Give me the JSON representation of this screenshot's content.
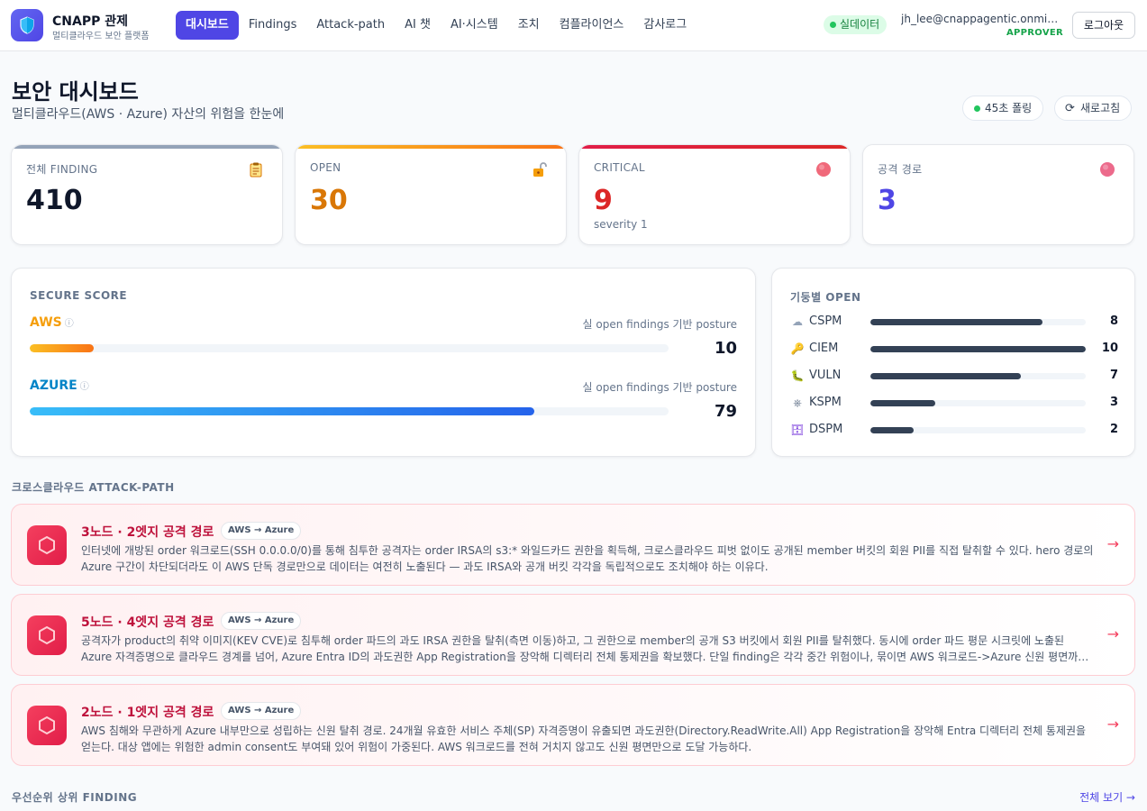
{
  "app": {
    "title": "CNAPP 관제",
    "subtitle": "멀티클라우드 보안 플랫폼"
  },
  "nav": {
    "items": [
      {
        "label": "대시보드",
        "active": true
      },
      {
        "label": "Findings"
      },
      {
        "label": "Attack-path"
      },
      {
        "label": "AI 챗"
      },
      {
        "label": "AI·시스템"
      },
      {
        "label": "조치"
      },
      {
        "label": "컴플라이언스"
      },
      {
        "label": "감사로그"
      }
    ]
  },
  "status": {
    "live_label": "실데이터"
  },
  "user": {
    "email": "jh_lee@cnappagentic.onmicrosoft.com",
    "role": "APPROVER",
    "logout_label": "로그아웃"
  },
  "page": {
    "title": "보안 대시보드",
    "subtitle": "멀티클라우드(AWS · Azure) 자산의 위험을 한눈에",
    "poll_label": "45초 폴링",
    "refresh_label": "새로고침"
  },
  "kpis": [
    {
      "label": "전체 FINDING",
      "value": "410",
      "note": "",
      "color": "#0f172a",
      "bar": "#94a3b8",
      "icon": "clipboard-icon"
    },
    {
      "label": "OPEN",
      "value": "30",
      "note": "",
      "color": "#d97706",
      "bar": "#f59e0b",
      "icon": "unlock-icon"
    },
    {
      "label": "CRITICAL",
      "value": "9",
      "note": "severity 1",
      "color": "#dc2626",
      "bar": "#e11d48",
      "icon": "critical-dot-icon"
    },
    {
      "label": "공격 경로",
      "value": "3",
      "note": "",
      "color": "#4f46e5",
      "bar": "#ffffff",
      "icon": "attack-dot-icon"
    }
  ],
  "secure_score": {
    "title": "SECURE SCORE",
    "providers": [
      {
        "name": "AWS",
        "info_icon": "info-icon",
        "note": "실 open findings 기반 posture",
        "value": 10,
        "display": "10",
        "color": "#f59e0b"
      },
      {
        "name": "AZURE",
        "info_icon": "info-icon",
        "note": "실 open findings 기반 posture",
        "value": 79,
        "display": "79",
        "color": "#0284c7"
      }
    ]
  },
  "pillars": {
    "title": "기둥별 OPEN",
    "max": 10,
    "items": [
      {
        "name": "CSPM",
        "value": 8,
        "display": "8",
        "icon": "cloud-icon",
        "glyph": "☁"
      },
      {
        "name": "CIEM",
        "value": 10,
        "display": "10",
        "icon": "key-icon",
        "glyph": "🔑"
      },
      {
        "name": "VULN",
        "value": 7,
        "display": "7",
        "icon": "bug-icon",
        "glyph": "🐛"
      },
      {
        "name": "KSPM",
        "value": 3,
        "display": "3",
        "icon": "helm-icon",
        "glyph": "⎈"
      },
      {
        "name": "DSPM",
        "value": 2,
        "display": "2",
        "icon": "database-icon",
        "glyph": "🗄"
      }
    ]
  },
  "attack_section": {
    "title": "크로스클라우드 ATTACK-PATH"
  },
  "attack_paths": [
    {
      "title": "3노드 · 2엣지 공격 경로",
      "badge": "AWS → Azure",
      "desc": "인터넷에 개방된 order 워크로드(SSH 0.0.0.0/0)를 통해 침투한 공격자는 order IRSA의 s3:* 와일드카드 권한을 획득해, 크로스클라우드 피벗 없이도 공개된 member 버킷의 회원 PII를 직접 탈취할 수 있다. hero 경로의 Azure 구간이 차단되더라도 이 AWS 단독 경로만으로 데이터는 여전히 노출된다 — 과도 IRSA와 공개 버킷 각각을 독립적으로도 조치해야 하는 이유다.",
      "arrow": "→"
    },
    {
      "title": "5노드 · 4엣지 공격 경로",
      "badge": "AWS → Azure",
      "desc": "공격자가 product의 취약 이미지(KEV CVE)로 침투해 order 파드의 과도 IRSA 권한을 탈취(측면 이동)하고, 그 권한으로 member의 공개 S3 버킷에서 회원 PII를 탈취했다. 동시에 order 파드 평문 시크릿에 노출된 Azure 자격증명으로 클라우드 경계를 넘어, Azure Entra ID의 과도권한 App Registration을 장악해 디렉터리 전체 통제권을 확보했다. 단일 finding은 각각 중간 위험이나, 묶이면 AWS 워크로드->Azure 신원 평면까지 이어지는 치명적 경로가 된다.",
      "arrow": "→"
    },
    {
      "title": "2노드 · 1엣지 공격 경로",
      "badge": "AWS → Azure",
      "desc": "AWS 침해와 무관하게 Azure 내부만으로 성립하는 신원 탈취 경로. 24개월 유효한 서비스 주체(SP) 자격증명이 유출되면 과도권한(Directory.ReadWrite.All) App Registration을 장악해 Entra 디렉터리 전체 통제권을 얻는다. 대상 앱에는 위험한 admin consent도 부여돼 있어 위험이 가중된다. AWS 워크로드를 전혀 거치지 않고도 신원 평면만으로 도달 가능하다.",
      "arrow": "→"
    }
  ],
  "priority_section": {
    "title": "우선순위 상위 FINDING",
    "see_all": "전체 보기 →"
  }
}
